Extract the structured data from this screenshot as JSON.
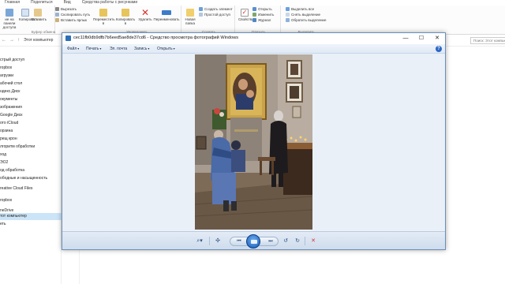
{
  "explorer": {
    "ribbon_tabs": [
      "Главная",
      "Поделиться",
      "Вид",
      "Средства работы с рисунками"
    ],
    "clipboard": {
      "pin_label": "Закрепить на панели быстрого доступа",
      "pin_short": "ие на панели доступа",
      "copy": "Копировать",
      "paste": "Вставить",
      "cut": "Вырезать",
      "copy_path": "Скопировать путь",
      "paste_shortcut": "Вставить ярлык",
      "group": "Буфер обмена"
    },
    "organize": {
      "move": "Переместить в",
      "copy_to": "Копировать в",
      "delete": "Удалить",
      "rename": "Переименовать",
      "group": "Упорядочить"
    },
    "create": {
      "new_folder": "Новая папка",
      "new_item": "Создать элемент",
      "easy_access": "Простой доступ",
      "group": "Создать"
    },
    "open": {
      "properties": "Свойства",
      "open": "Открыть",
      "edit": "Изменить",
      "history": "Журнал",
      "group": "Открыть"
    },
    "select": {
      "select_all": "Выделить все",
      "select_none": "Снять выделение",
      "invert": "Обратить выделение",
      "group": "Выделить"
    },
    "address": "Этот компьютер",
    "search_placeholder": "Поиск: Этот компьютер",
    "nav_items": [
      "Быстрый доступ",
      "Dropbox",
      "Загрузки",
      "Рабочий стол",
      "Яндекс.Диск",
      "Документы",
      "Изображения",
      "Google Диск",
      "Фото iCloud",
      "Корзина",
      "крещ крон",
      "алгоритм обработки",
      "Вход",
      "ЭКО2",
      "под обработка",
      "Свободные и насыщенность",
      "Creative Cloud Files",
      "Dropbox",
      "OneDrive",
      "Этот компьютер",
      "Сеть"
    ],
    "nav_items_cropped": [
      "стрый доступ",
      "ropbox",
      "агрузки",
      "абочий стол",
      "ндекс.Диск",
      "окументы",
      "зображения",
      "Google Диск",
      "ото iCloud",
      "орзина",
      "рещ крон",
      "лгоритм обработки",
      "ход",
      "ЭО2",
      "од обработка",
      "ободные и насыщенность",
      "reative Cloud Files",
      "ropbox",
      "neDrive",
      "тот компьютер",
      "еть"
    ],
    "selected_nav_index": 19
  },
  "viewer": {
    "title": "cec11fb0db9dfb7b6eed5ae8de37cd6 - Средство просмотра фотографий Windows",
    "menu": [
      {
        "label": "Файл",
        "caret": "▾"
      },
      {
        "label": "Печать",
        "caret": "▾"
      },
      {
        "label": "Эл. почта",
        "caret": ""
      },
      {
        "label": "Запись",
        "caret": "▾"
      },
      {
        "label": "Открыть",
        "caret": "▾"
      }
    ],
    "help": "?",
    "window_controls": {
      "minimize": "—",
      "maximize": "☐",
      "close": "✕"
    },
    "toolbar": {
      "zoom": "⌕▾",
      "actual_size": "✣",
      "previous": "⏮",
      "next": "⏭",
      "rotate_left": "↺",
      "rotate_right": "↻",
      "delete": "✕"
    }
  },
  "colors": {
    "window_border": "#6a8fb9",
    "viewer_background": "#eaf0f7",
    "toolbar_accent": "#1559b4",
    "delete_red": "#d9302c",
    "selected_nav": "#cce4f7"
  }
}
